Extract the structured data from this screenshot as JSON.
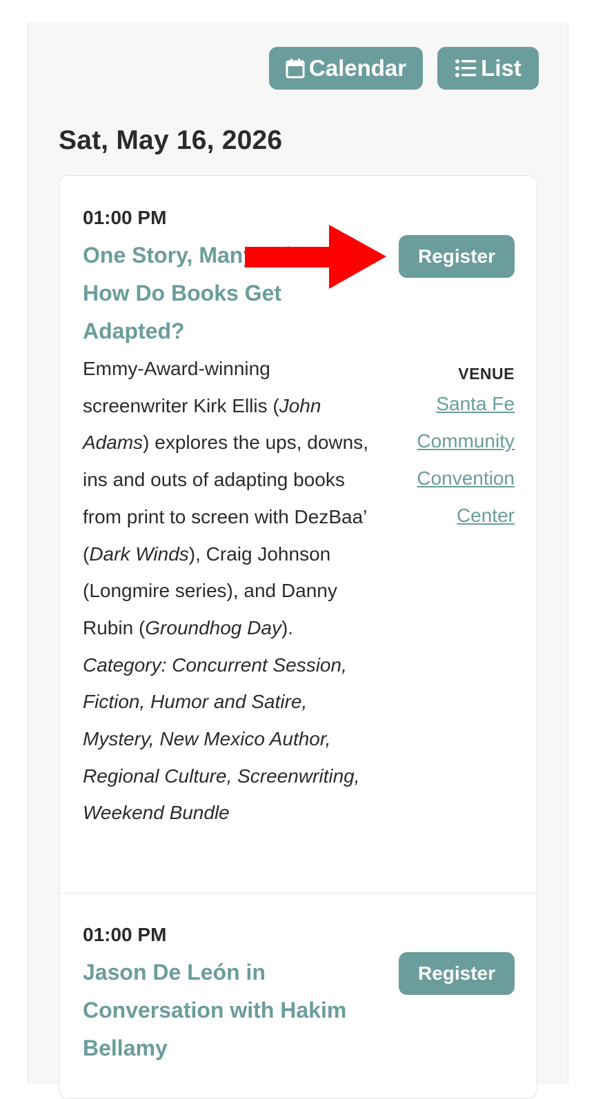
{
  "toolbar": {
    "calendar_label": "Calendar",
    "list_label": "List"
  },
  "date_heading": "Sat, May 16, 2026",
  "events": [
    {
      "time": "01:00 PM",
      "title": "One Story, Many Tales: How Do Books Get Adapted?",
      "register_label": "Register",
      "description": {
        "p1": "Emmy-Award-winning screenwriter Kirk Ellis (",
        "i1": "John Adams",
        "p2": ") explores the ups, downs, ins and outs of adapting books from print to screen with DezBaa’ (",
        "i2": "Dark Winds",
        "p3": "), Craig Johnson (Longmire series), and Danny Rubin (",
        "i3": "Groundhog Day",
        "p4": ")."
      },
      "category": "Category: Concurrent Session, Fiction, Humor and Satire, Mystery, New Mexico Author, Regional Culture, Screenwriting, Weekend Bundle",
      "venue_label": "VENUE",
      "venue_name": "Santa Fe Community Convention Center"
    },
    {
      "time": "01:00 PM",
      "title": "Jason De León in Conversation with Hakim Bellamy",
      "register_label": "Register"
    }
  ],
  "colors": {
    "accent": "#6a9d9b",
    "annotation_arrow": "#ff0000",
    "panel_bg": "#f6f7f6"
  },
  "icons": {
    "calendar": "calendar-icon",
    "list": "list-icon",
    "annotation": "red-arrow-pointer"
  }
}
